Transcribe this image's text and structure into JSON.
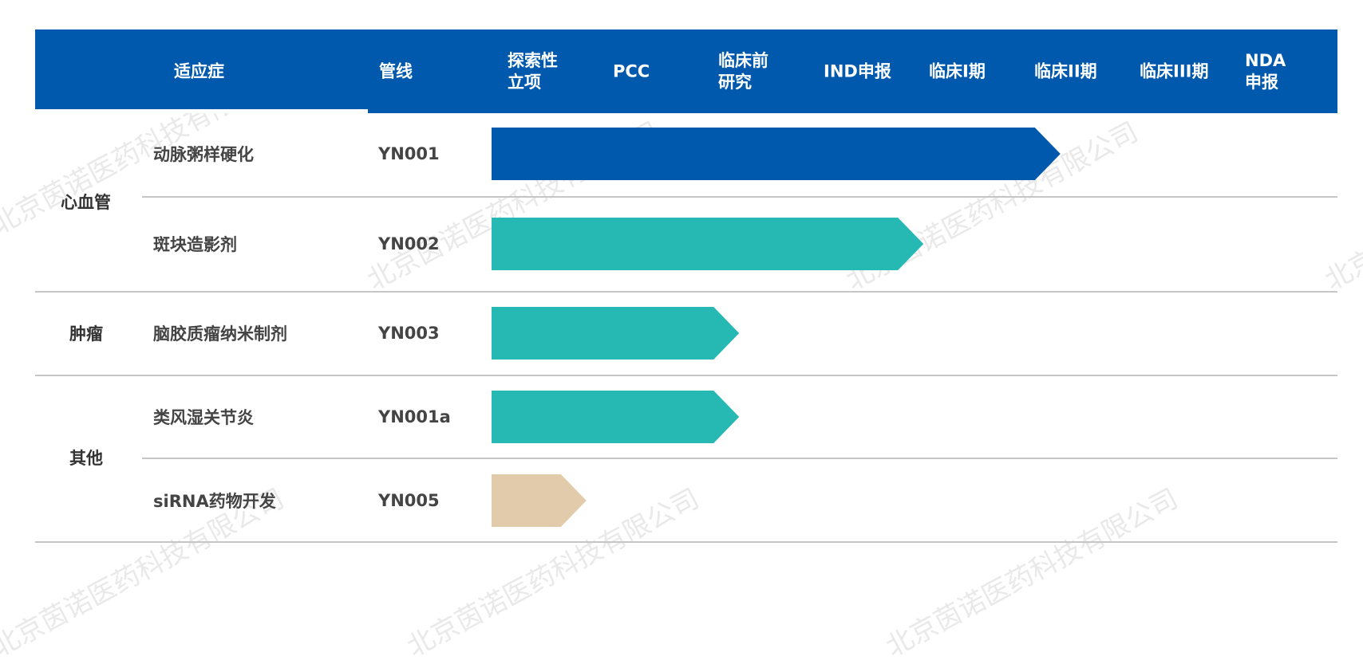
{
  "watermark": "北京茵诺医药科技有限公司",
  "header": {
    "indication": "适应症",
    "pipeline": "管线",
    "stages": [
      "探索性\n立项",
      "PCC",
      "临床前\n研究",
      "IND申报",
      "临床I期",
      "临床II期",
      "临床III期",
      "NDA\n申报"
    ]
  },
  "categories": [
    {
      "name": "心血管"
    },
    {
      "name": "肿瘤"
    },
    {
      "name": "其他"
    }
  ],
  "chart_data": {
    "type": "bar",
    "title": "",
    "stages": [
      "探索性立项",
      "PCC",
      "临床前研究",
      "IND申报",
      "临床I期",
      "临床II期",
      "临床III期",
      "NDA申报"
    ],
    "rows": [
      {
        "category": "心血管",
        "indication": "动脉粥样硬化",
        "code": "YN001",
        "progress_stage_units": 5.4,
        "color": "#0059ac"
      },
      {
        "category": "心血管",
        "indication": "斑块造影剂",
        "code": "YN002",
        "progress_stage_units": 4.1,
        "color": "#26b8b3"
      },
      {
        "category": "肿瘤",
        "indication": "脑胶质瘤纳米制剂",
        "code": "YN003",
        "progress_stage_units": 2.35,
        "color": "#26b8b3"
      },
      {
        "category": "其他",
        "indication": "类风湿关节炎",
        "code": "YN001a",
        "progress_stage_units": 2.35,
        "color": "#26b8b3"
      },
      {
        "category": "其他",
        "indication": "siRNA药物开发",
        "code": "YN005",
        "progress_stage_units": 0.9,
        "color": "#e2cbab"
      }
    ]
  }
}
